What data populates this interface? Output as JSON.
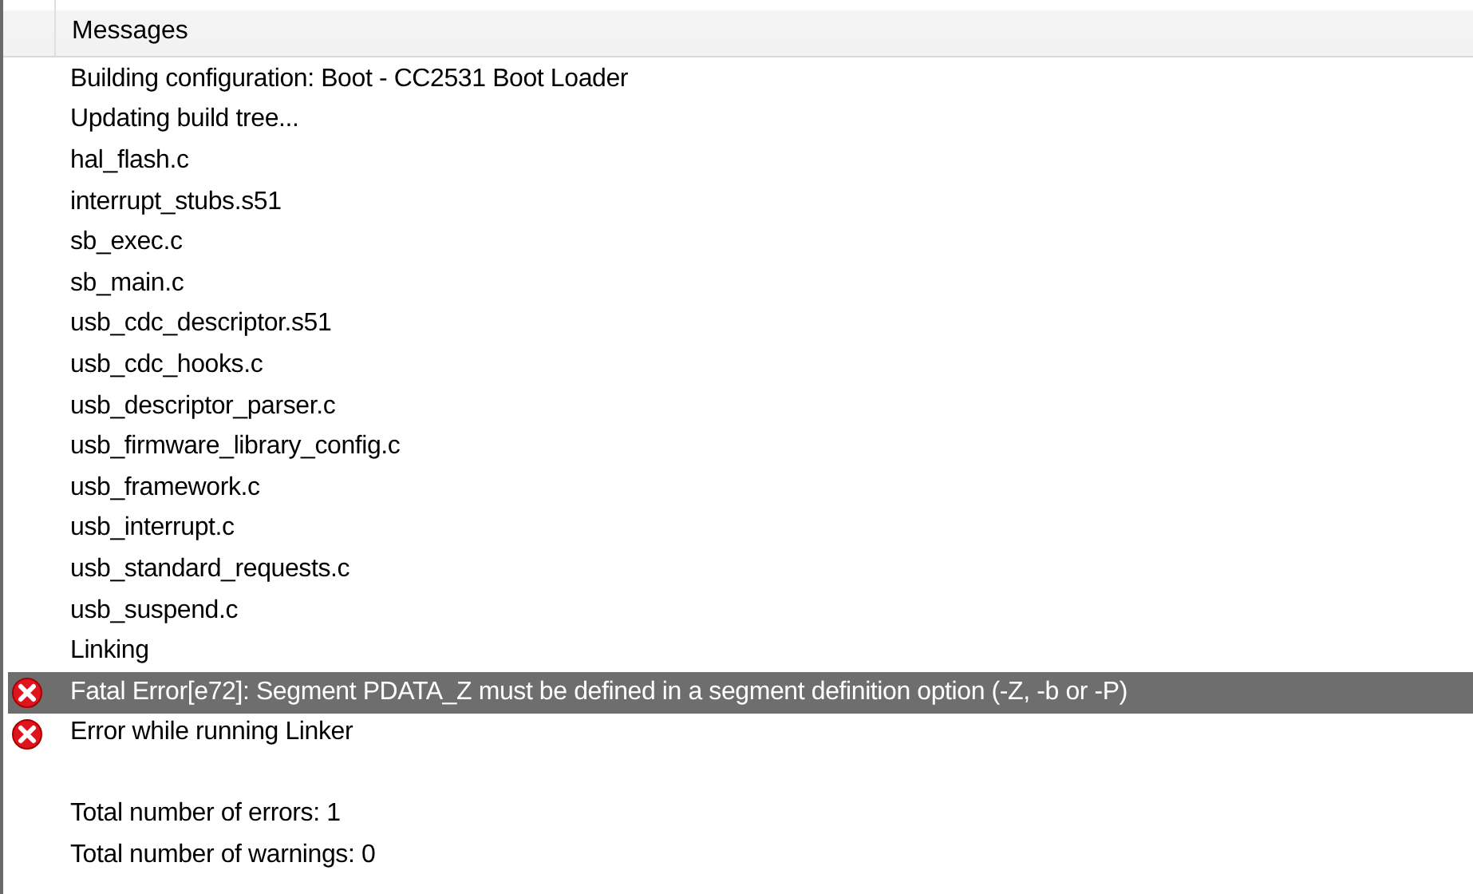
{
  "header": {
    "title": "Messages"
  },
  "messages": [
    {
      "text": "Building configuration: Boot - CC2531 Boot Loader",
      "kind": "info",
      "selected": false
    },
    {
      "text": "Updating build tree...",
      "kind": "info",
      "selected": false
    },
    {
      "text": "hal_flash.c",
      "kind": "info",
      "selected": false
    },
    {
      "text": "interrupt_stubs.s51",
      "kind": "info",
      "selected": false
    },
    {
      "text": "sb_exec.c",
      "kind": "info",
      "selected": false
    },
    {
      "text": "sb_main.c",
      "kind": "info",
      "selected": false
    },
    {
      "text": "usb_cdc_descriptor.s51",
      "kind": "info",
      "selected": false
    },
    {
      "text": "usb_cdc_hooks.c",
      "kind": "info",
      "selected": false
    },
    {
      "text": "usb_descriptor_parser.c",
      "kind": "info",
      "selected": false
    },
    {
      "text": "usb_firmware_library_config.c",
      "kind": "info",
      "selected": false
    },
    {
      "text": "usb_framework.c",
      "kind": "info",
      "selected": false
    },
    {
      "text": "usb_interrupt.c",
      "kind": "info",
      "selected": false
    },
    {
      "text": "usb_standard_requests.c",
      "kind": "info",
      "selected": false
    },
    {
      "text": "usb_suspend.c",
      "kind": "info",
      "selected": false
    },
    {
      "text": "Linking",
      "kind": "info",
      "selected": false
    },
    {
      "text": "Fatal Error[e72]: Segment PDATA_Z must be defined in a segment definition option (-Z, -b or -P)",
      "kind": "error",
      "selected": true
    },
    {
      "text": "Error while running Linker",
      "kind": "error",
      "selected": false
    }
  ],
  "summary": [
    {
      "text": "Total number of errors: 1",
      "selected": false
    },
    {
      "text": "Total number of warnings: 0",
      "selected": false
    }
  ]
}
